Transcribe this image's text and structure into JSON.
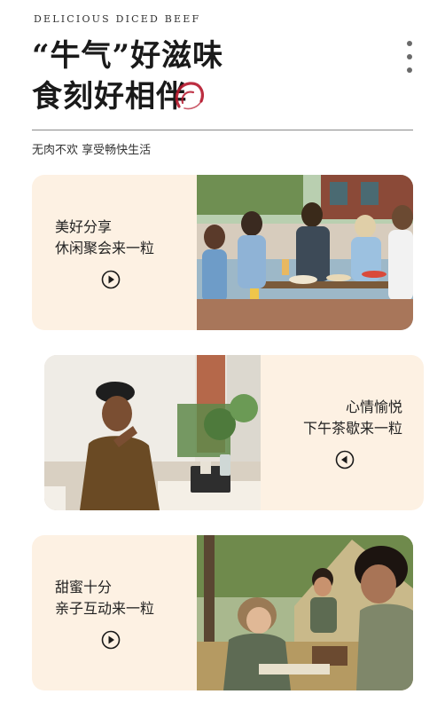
{
  "header": {
    "eyebrow": "DELICIOUS DICED BEEF",
    "title_line1": "“牛气”好滋味",
    "title_line2": "食刻好相伴",
    "subtitle": "无肉不欢 享受畅快生活"
  },
  "colors": {
    "card_bg": "#fdf1e3",
    "seal_red": "#b5162b",
    "text": "#1a1a1a"
  },
  "cards": [
    {
      "line1": "美好分享",
      "line2": "休闲聚会来一粒",
      "icon": "play-circle-right",
      "photo": "friends-dining-outdoors"
    },
    {
      "line1": "心情愉悦",
      "line2": "下午茶歇来一粒",
      "icon": "play-circle-left",
      "photo": "man-thinking-at-desk"
    },
    {
      "line1": "甜蜜十分",
      "line2": "亲子互动来一粒",
      "icon": "play-circle-right",
      "photo": "children-playing-board-game-camping"
    }
  ]
}
